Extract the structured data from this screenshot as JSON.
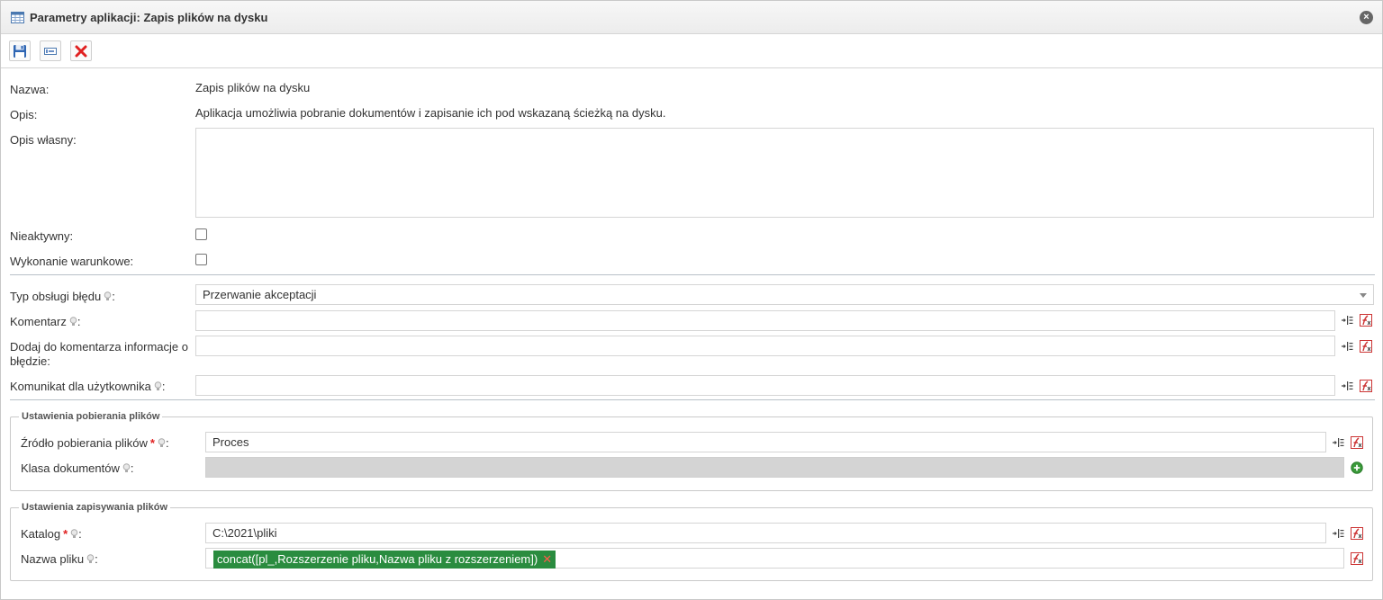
{
  "window": {
    "title": "Parametry aplikacji: Zapis plików na dysku",
    "close_symbol": "×"
  },
  "toolbar": {
    "buttons": [
      {
        "name": "save-icon"
      },
      {
        "name": "edit-field-icon"
      },
      {
        "name": "delete-icon"
      }
    ]
  },
  "form": {
    "name_label": "Nazwa:",
    "name_value": "Zapis plików na dysku",
    "desc_label": "Opis:",
    "desc_value": "Aplikacja umożliwia pobranie dokumentów i zapisanie ich pod wskazaną ścieżką na dysku.",
    "own_desc_label": "Opis własny:",
    "own_desc_value": "",
    "inactive_label": "Nieaktywny:",
    "inactive_checked": false,
    "conditional_label": "Wykonanie warunkowe:",
    "conditional_checked": false
  },
  "error_handling": {
    "type_label": "Typ obsługi błędu",
    "type_value": "Przerwanie akceptacji",
    "comment_label": "Komentarz",
    "comment_value": "",
    "add_info_label": "Dodaj do komentarza informacje o błędzie:",
    "add_info_value": "",
    "user_msg_label": "Komunikat dla użytkownika",
    "user_msg_value": ""
  },
  "download_settings": {
    "legend": "Ustawienia pobierania plików",
    "source_label": "Źródło pobierania plików",
    "source_value": "Proces",
    "doc_class_label": "Klasa dokumentów"
  },
  "save_settings": {
    "legend": "Ustawienia zapisywania plików",
    "catalog_label": "Katalog",
    "catalog_value": "C:\\2021\\pliki",
    "filename_label": "Nazwa pliku",
    "filename_tag": "concat([pl_,Rozszerzenie pliku,Nazwa pliku z rozszerzeniem])",
    "tag_remove": "✕"
  },
  "colors": {
    "tag_bg": "#2a8c3f",
    "required": "#e02020",
    "delete_red": "#e02020"
  }
}
